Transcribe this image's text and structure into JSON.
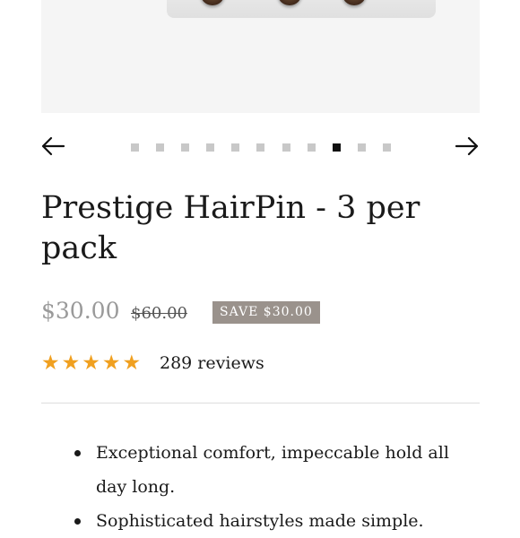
{
  "product": {
    "title": "Prestige HairPin - 3 per pack",
    "price": "$30.00",
    "compare_price": "$60.00",
    "save_badge": "SAVE $30.00",
    "rating": 5,
    "stars": [
      "★",
      "★",
      "★",
      "★",
      "★"
    ],
    "reviews": "289 reviews"
  },
  "gallery": {
    "slide_count": 11,
    "active_slide": 9,
    "prev_icon": "arrow-left-icon",
    "next_icon": "arrow-right-icon"
  },
  "features": [
    "Exceptional comfort, impeccable hold all day long.",
    "Sophisticated hairstyles made simple."
  ],
  "colors": {
    "star": "#f0a020",
    "badge": "#9a928c",
    "price": "#9a9a9a",
    "active_dot": "#111111",
    "inactive_dot": "#c8c8c8"
  }
}
